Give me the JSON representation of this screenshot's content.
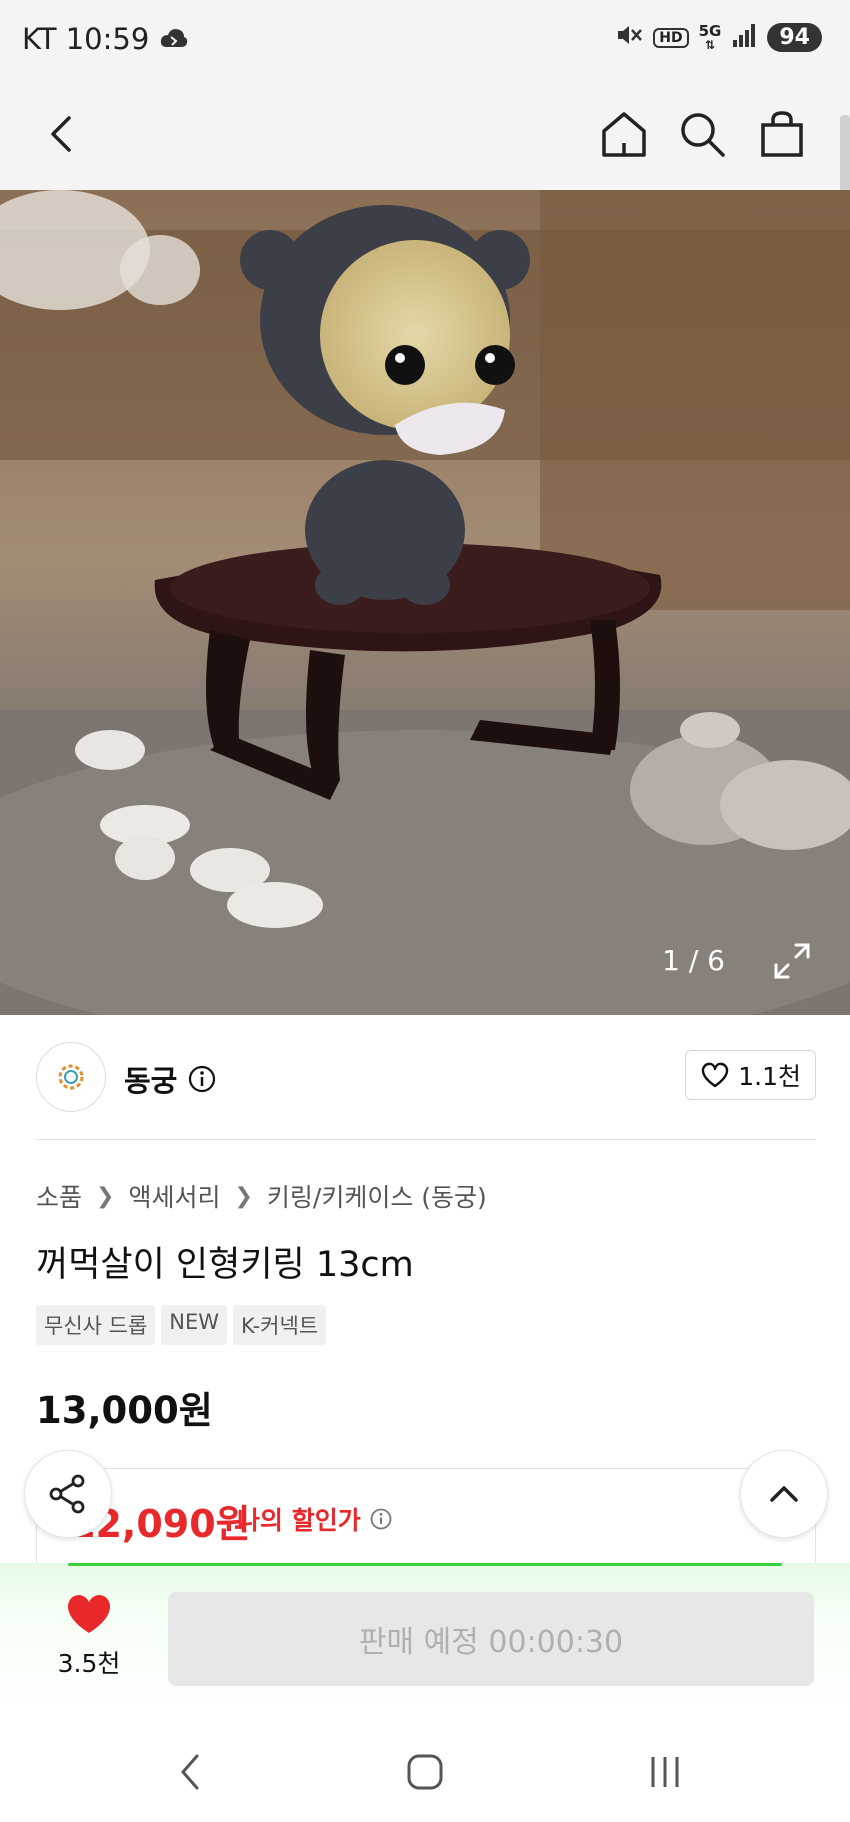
{
  "status_bar": {
    "carrier_time": "KT 10:59",
    "network": "5G",
    "hd": "HD",
    "battery": "94",
    "icons": [
      "cloud-icon",
      "mute-icon",
      "hd-icon",
      "5g-icon",
      "signal-icon",
      "battery-icon"
    ]
  },
  "top_nav": {
    "icons": [
      "back-icon",
      "home-icon",
      "search-icon",
      "shopping-bag-icon"
    ]
  },
  "gallery": {
    "counter": "1 / 6",
    "image_subject": "plush keyring doll on small wooden table"
  },
  "brand": {
    "name": "동궁",
    "likes": "1.1천"
  },
  "breadcrumb": [
    "소품",
    "액세서리",
    "키링/키케이스 (동궁)"
  ],
  "product": {
    "title": "꺼먹살이 인형키링 13cm",
    "tags": [
      "무신사 드롭",
      "NEW",
      "K-커넥트"
    ],
    "price": "13,000원"
  },
  "discount": {
    "price": "12,090원",
    "label": "나의 할인가"
  },
  "bottom_bar": {
    "favorite_count": "3.5천",
    "buy_label": "판매 예정 00:00:30"
  },
  "colors": {
    "accent_red": "#e8282a",
    "green_bar": "#3bd13b",
    "disabled_button": "#e7e7e7"
  }
}
